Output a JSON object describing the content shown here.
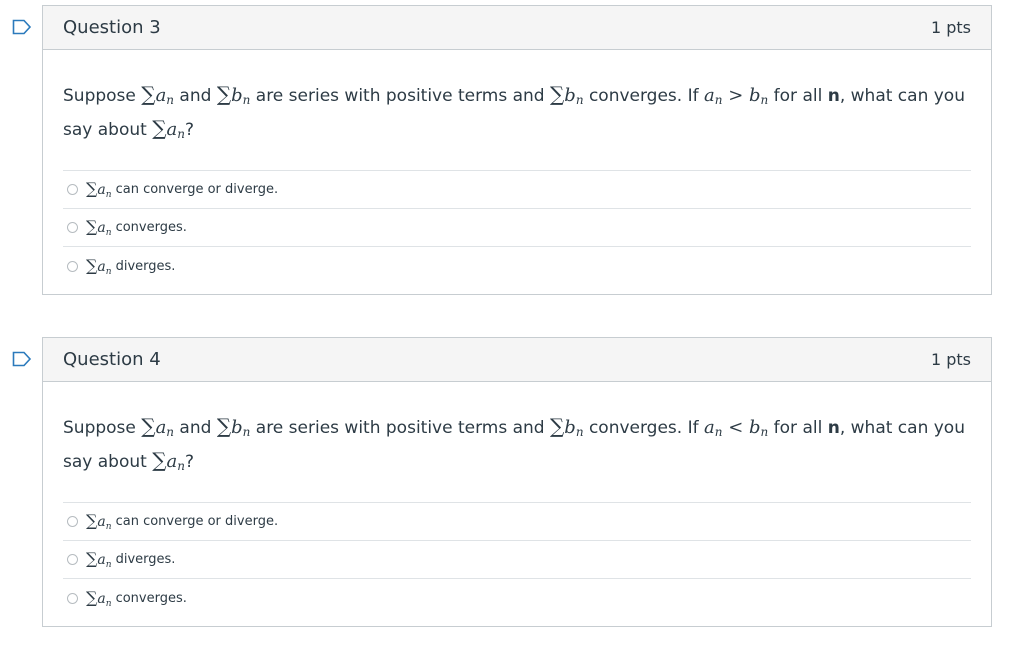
{
  "questions": [
    {
      "title": "Question 3",
      "points": "1 pts",
      "text": {
        "p1": "Suppose ",
        "s1": "∑",
        "v1": "a",
        "sub1": "n",
        "p2": " and ",
        "s2": "∑",
        "v2": "b",
        "sub2": "n",
        "p3": " are series with positive terms and ",
        "s3": "∑",
        "v3": "b",
        "sub3": "n",
        "p4": " converges. If ",
        "v4": "a",
        "sub4": "n",
        "op": " > ",
        "v5": "b",
        "sub5": "n",
        "p5": " for all ",
        "bold": "n",
        "p6": ", what can you say about ",
        "s4": "∑",
        "v6": "a",
        "sub6": "n",
        "p7": "?"
      },
      "answers": [
        {
          "sigma": "∑",
          "var": "a",
          "sub": "n",
          "label": "can converge or diverge."
        },
        {
          "sigma": "∑",
          "var": "a",
          "sub": "n",
          "label": "converges."
        },
        {
          "sigma": "∑",
          "var": "a",
          "sub": "n",
          "label": "diverges."
        }
      ]
    },
    {
      "title": "Question 4",
      "points": "1 pts",
      "text": {
        "p1": "Suppose ",
        "s1": "∑",
        "v1": "a",
        "sub1": "n",
        "p2": " and ",
        "s2": "∑",
        "v2": "b",
        "sub2": "n",
        "p3": " are series with positive terms and ",
        "s3": "∑",
        "v3": "b",
        "sub3": "n",
        "p4": " converges. If ",
        "v4": "a",
        "sub4": "n",
        "op": " < ",
        "v5": "b",
        "sub5": "n",
        "p5": " for all ",
        "bold": "n",
        "p6": ", what can you say about ",
        "s4": "∑",
        "v6": "a",
        "sub6": "n",
        "p7": "?"
      },
      "answers": [
        {
          "sigma": "∑",
          "var": "a",
          "sub": "n",
          "label": "can converge or diverge."
        },
        {
          "sigma": "∑",
          "var": "a",
          "sub": "n",
          "label": "diverges."
        },
        {
          "sigma": "∑",
          "var": "a",
          "sub": "n",
          "label": "converges."
        }
      ]
    }
  ],
  "colors": {
    "flag": "#2b7abc",
    "border": "#c7cdd1",
    "header_bg": "#f5f5f5"
  },
  "icons": {
    "flag": "bookmark-flag-icon"
  }
}
